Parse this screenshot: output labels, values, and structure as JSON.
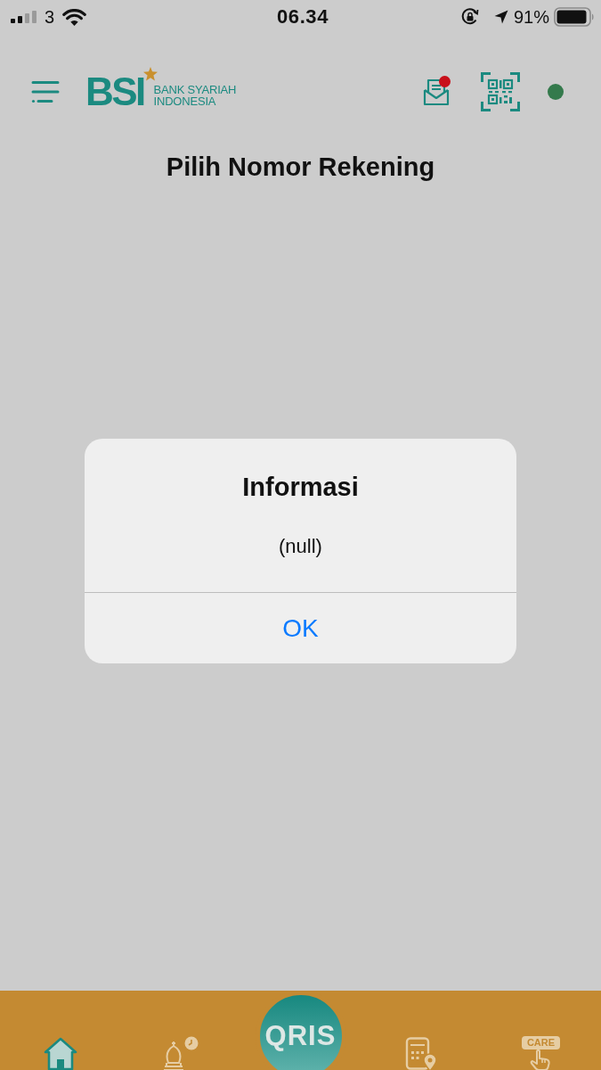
{
  "status_bar": {
    "carrier": "3",
    "time": "06.34",
    "battery": "91%"
  },
  "header": {
    "logo": {
      "wordmark": "BSI",
      "bank_name": "BANK SYARIAH INDONESIA"
    },
    "inbox_unread": true
  },
  "page_title": "Pilih Nomor Rekening",
  "dialog": {
    "title": "Informasi",
    "message": "(null)",
    "buttons": [
      "OK"
    ]
  },
  "bottom_nav": [
    {
      "kind": "home",
      "selected": true
    },
    {
      "kind": "prayer",
      "selected": false
    },
    {
      "kind": "qris",
      "label": "QRIS",
      "selected": false
    },
    {
      "kind": "atm",
      "selected": false
    },
    {
      "kind": "care",
      "label": "CARE",
      "selected": false
    }
  ]
}
